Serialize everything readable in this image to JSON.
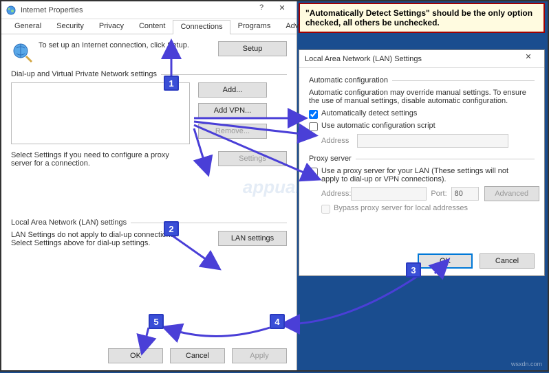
{
  "callout_text": "\"Automatically Detect Settings\" should be the only option checked, all others be unchecked.",
  "ip": {
    "title": "Internet Properties",
    "tabs": {
      "general": "General",
      "security": "Security",
      "privacy": "Privacy",
      "content": "Content",
      "connections": "Connections",
      "programs": "Programs",
      "advanced": "Advanced"
    },
    "setup_text": "To set up an Internet connection, click Setup.",
    "setup_btn": "Setup",
    "dialup_header": "Dial-up and Virtual Private Network settings",
    "add_btn": "Add...",
    "addvpn_btn": "Add VPN...",
    "remove_btn": "Remove...",
    "settings_btn": "Settings",
    "select_text": "Select Settings if you need to configure a proxy server for a connection.",
    "lan_header": "Local Area Network (LAN) settings",
    "lan_text": "LAN Settings do not apply to dial-up connections. Select Settings above for dial-up settings.",
    "lan_btn": "LAN settings",
    "ok": "OK",
    "cancel": "Cancel",
    "apply": "Apply"
  },
  "lan": {
    "title": "Local Area Network (LAN) Settings",
    "auto_header": "Automatic configuration",
    "auto_desc": "Automatic configuration may override manual settings.  To ensure the use of manual settings, disable automatic configuration.",
    "auto_detect": "Automatically detect settings",
    "auto_script": "Use automatic configuration script",
    "address": "Address",
    "proxy_header": "Proxy server",
    "proxy_use": "Use a proxy server for your LAN (These settings will not apply to dial-up or VPN connections).",
    "proxy_address": "Address:",
    "port": "Port:",
    "port_value": "80",
    "advanced": "Advanced",
    "bypass": "Bypass proxy server for local addresses",
    "ok": "OK",
    "cancel": "Cancel"
  },
  "markers": {
    "m1": "1",
    "m2": "2",
    "m3": "3",
    "m4": "4",
    "m5": "5"
  },
  "watermark": "wsxdn.com",
  "brand": "appuals"
}
